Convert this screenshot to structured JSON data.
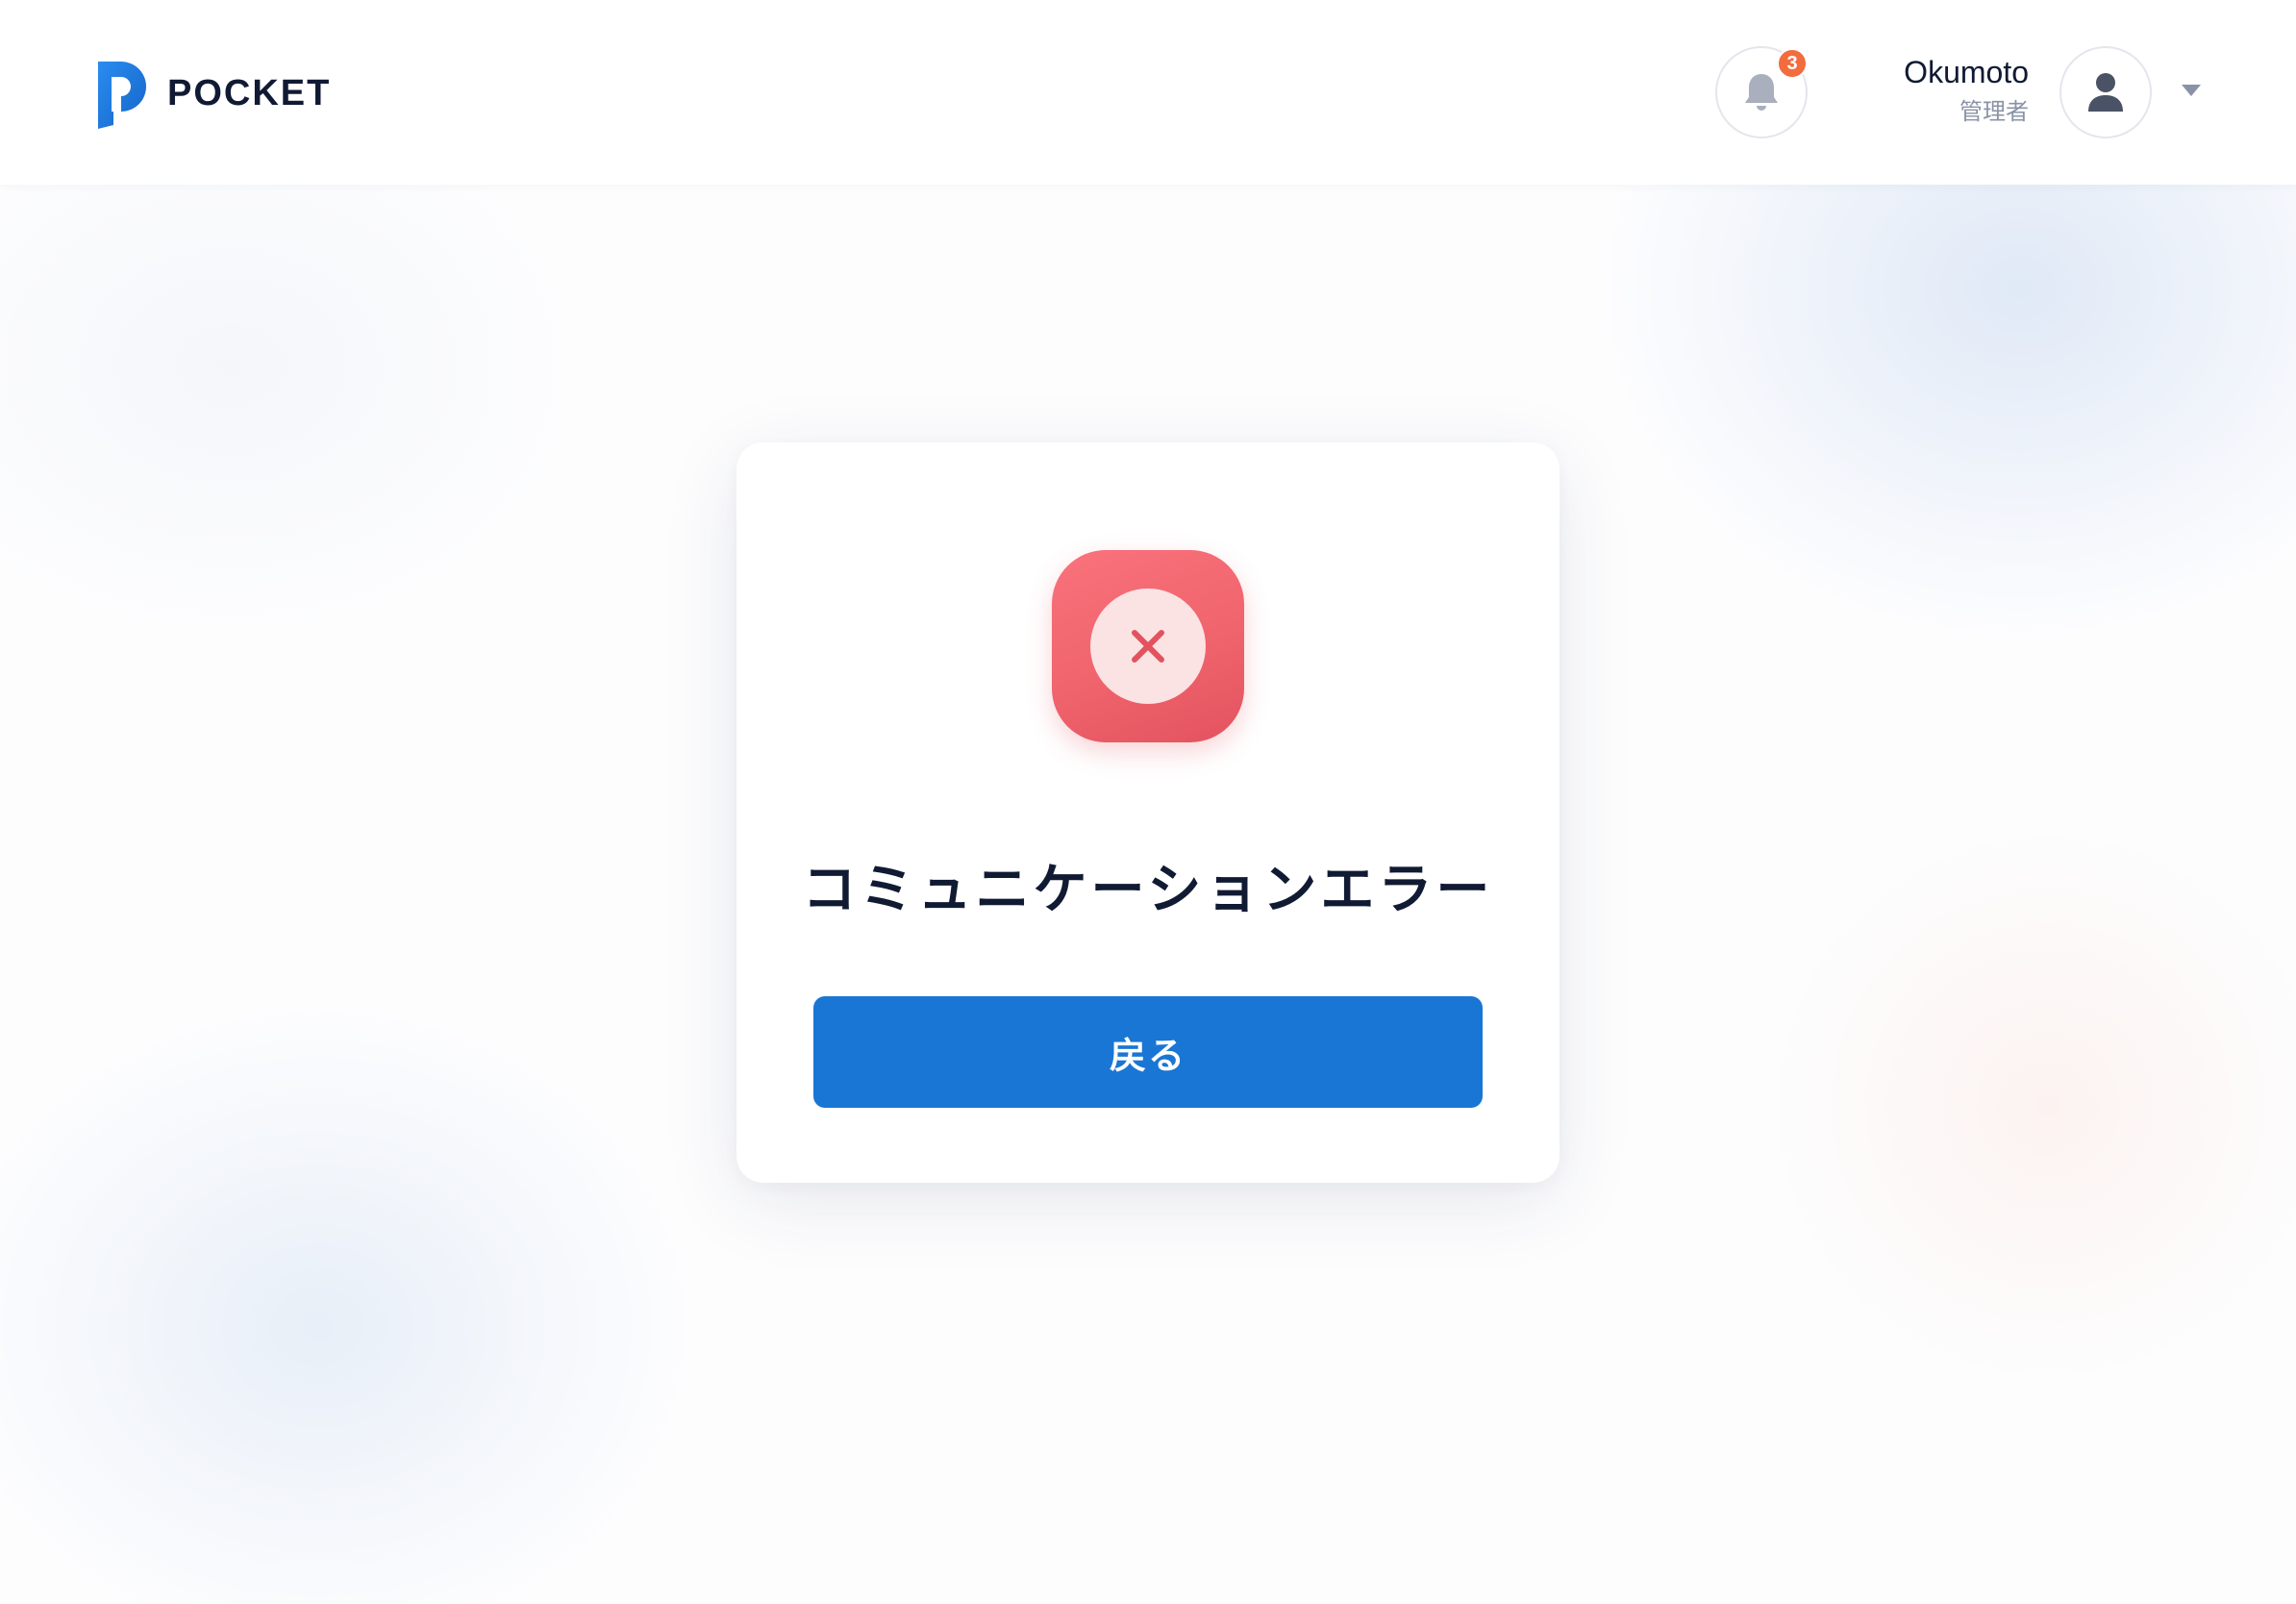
{
  "header": {
    "brand_name": "POCKET",
    "notifications": {
      "count": "3",
      "icon": "bell-icon"
    },
    "user": {
      "name": "Okumoto",
      "role": "管理者",
      "avatar_icon": "person-icon",
      "menu_icon": "caret-down-icon"
    }
  },
  "error_card": {
    "icon": "close-icon",
    "title": "コミュニケーションエラー",
    "back_button_label": "戻る"
  },
  "colors": {
    "brand_blue": "#1976d4",
    "error_red": "#f0646d",
    "badge_orange": "#f26c3d",
    "text_dark": "#101a33",
    "text_muted": "#8a93a6"
  }
}
